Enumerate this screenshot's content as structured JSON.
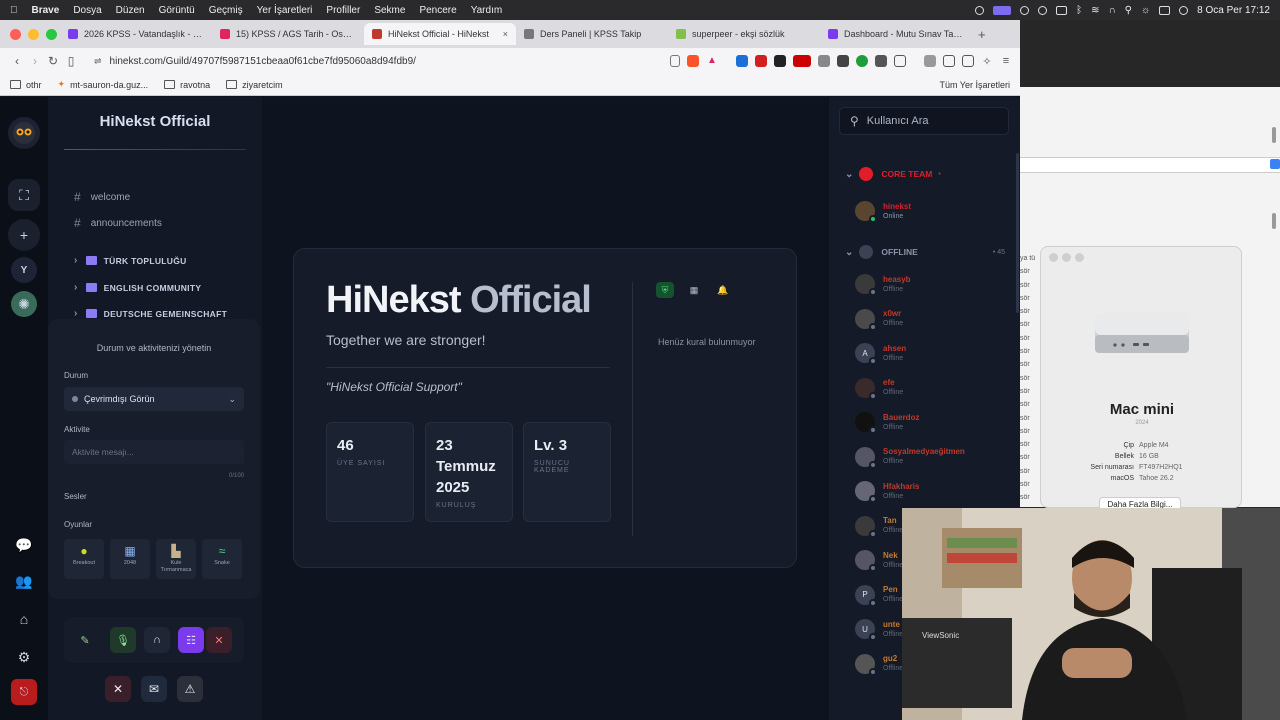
{
  "menubar": {
    "app": "Brave",
    "items": [
      "Dosya",
      "Düzen",
      "Görüntü",
      "Geçmiş",
      "Yer İşaretleri",
      "Profiller",
      "Sekme",
      "Pencere",
      "Yardım"
    ],
    "datetime": "8 Oca Per  17:12"
  },
  "tabs": [
    {
      "label": "2026 KPSS - Vatandaşlık - Emir",
      "color": "#7c3aed"
    },
    {
      "label": "15) KPSS / AGS Tarih - Osmanlı",
      "color": "#e0245e"
    },
    {
      "label": "HiNekst Official - HiNekst",
      "color": "#c0392b",
      "active": true
    },
    {
      "label": "Ders Paneli | KPSS Takip",
      "color": "#777777"
    },
    {
      "label": "superpeer - ekşi sözlük",
      "color": "#81c14b"
    },
    {
      "label": "Dashboard - Mutu Sınav Takip",
      "color": "#7c3aed"
    }
  ],
  "address": {
    "url": "hinekst.com/Guild/49707f5987151cbeaa0f61cbe7fd95060a8d94fdb9/"
  },
  "bookmarks": [
    "othr",
    "mt-sauron-da.guz...",
    "ravotna",
    "ziyaretcim"
  ],
  "bookmarks_all": "Tüm Yer İşaretleri",
  "rail": {
    "letter": "Y"
  },
  "server": {
    "name": "HiNekst Official",
    "channels": [
      "welcome",
      "announcements"
    ],
    "categories": [
      "TÜRK TOPLULUĞU",
      "ENGLISH COMMUNITY",
      "DEUTSCHE GEMEINSCHAFT"
    ]
  },
  "status_panel": {
    "title": "Durum ve aktivitenizi yönetin",
    "status_label": "Durum",
    "status_value": "Çevrimdışı Görün",
    "activity_label": "Aktivite",
    "activity_placeholder": "Aktivite mesajı...",
    "char_count": "0/100",
    "sounds_label": "Sesler",
    "games_label": "Oyunlar",
    "games": [
      {
        "icon": "●",
        "name": "Breakout"
      },
      {
        "icon": "▦",
        "name": "2048"
      },
      {
        "icon": "▙",
        "name": "Kule Tırmanmaca"
      },
      {
        "icon": "≈",
        "name": "Snake"
      }
    ]
  },
  "card": {
    "title_main": "HiNekst",
    "title_accent": "Official",
    "tagline": "Together we are stronger!",
    "quote": "\"HiNekst Official Support\"",
    "stats": [
      {
        "value": "46",
        "label": "ÜYE SAYISI"
      },
      {
        "value": "23 Temmuz 2025",
        "label": "KURULUŞ"
      },
      {
        "value": "Lv. 3",
        "label": "SUNUCU KADEME"
      }
    ],
    "no_rules": "Henüz kural bulunmuyor"
  },
  "members": {
    "search_placeholder": "Kullanıcı Ara",
    "groups": [
      {
        "name": "CORE TEAM",
        "color": "#e11d2a",
        "count": "•"
      },
      {
        "name": "OFFLINE",
        "color": "#8a94a8",
        "count": "• 45"
      }
    ],
    "online": [
      {
        "name": "hinekst",
        "status": "Online",
        "color": "#e11d2a"
      }
    ],
    "offline": [
      {
        "name": "heasyb",
        "status": "Offline",
        "color": "#c0392b",
        "initial": ""
      },
      {
        "name": "x0wr",
        "status": "Offline",
        "color": "#c0392b",
        "initial": ""
      },
      {
        "name": "ahsen",
        "status": "Offline",
        "color": "#c0392b",
        "initial": "A"
      },
      {
        "name": "efe",
        "status": "Offline",
        "color": "#c0392b",
        "initial": ""
      },
      {
        "name": "Bauerdoz",
        "status": "Offline",
        "color": "#c0392b",
        "initial": ""
      },
      {
        "name": "Sosyalmedyaeğitmen",
        "status": "Offline",
        "color": "#c0392b",
        "initial": ""
      },
      {
        "name": "Hfakharis",
        "status": "Offline",
        "color": "#c0392b",
        "initial": ""
      },
      {
        "name": "Tan",
        "status": "Offline",
        "color": "#c77a2c",
        "initial": ""
      },
      {
        "name": "Nek",
        "status": "Offline",
        "color": "#c77a2c",
        "initial": ""
      },
      {
        "name": "Pen",
        "status": "Offline",
        "color": "#c77a2c",
        "initial": "P"
      },
      {
        "name": "unte",
        "status": "Offline",
        "color": "#c77a2c",
        "initial": "U"
      },
      {
        "name": "gu2",
        "status": "Offline",
        "color": "#c77a2c",
        "initial": ""
      }
    ]
  },
  "about_mac": {
    "model": "Mac mini",
    "year": "2024",
    "specs": [
      {
        "k": "Çip",
        "v": "Apple M4"
      },
      {
        "k": "Bellek",
        "v": "16 GB"
      },
      {
        "k": "Seri numarası",
        "v": "FT497H2HQ1"
      },
      {
        "k": "macOS",
        "v": "Tahoe 26.2"
      }
    ],
    "more_button": "Daha Fazla Bilgi...",
    "side_text": [
      "ya tü",
      "sör",
      "sör",
      "sör",
      "sör",
      "sör",
      "sör",
      "sör",
      "sör",
      "sör",
      "sör",
      "sör",
      "sör",
      "sör",
      "sör",
      "sör",
      "sör",
      "sör",
      "sör"
    ]
  },
  "webcam": {
    "monitor_brand": "ViewSonic"
  }
}
